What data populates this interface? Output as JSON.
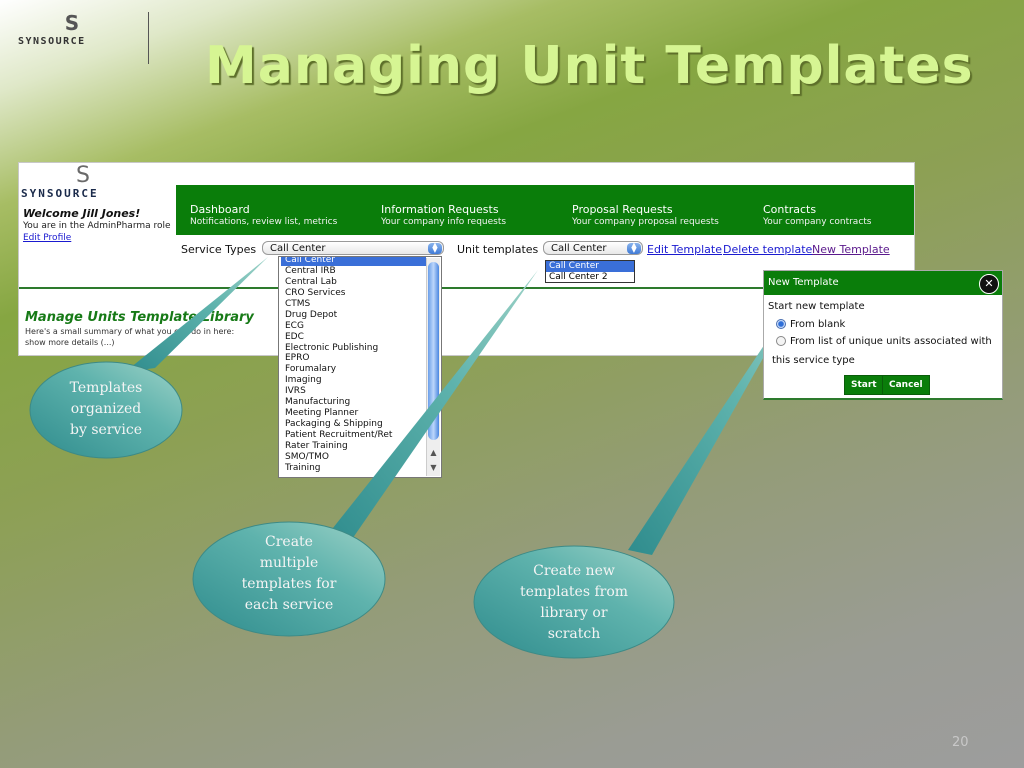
{
  "slide": {
    "title": "Managing Unit Templates",
    "logo_glyph": "S",
    "logo_wordmark": "SYNSOURCE",
    "page_number": "20"
  },
  "app": {
    "logo_glyph": "S",
    "logo_wordmark": "SYNSOURCE",
    "welcome": "Welcome Jill Jones!",
    "role_text": "You are in the AdminPharma role",
    "edit_profile": "Edit Profile",
    "nav": [
      {
        "label": "Dashboard",
        "sub": "Notifications, review list, metrics"
      },
      {
        "label": "Information Requests",
        "sub": "Your company info requests"
      },
      {
        "label": "Proposal Requests",
        "sub": "Your company proposal requests"
      },
      {
        "label": "Contracts",
        "sub": "Your company contracts"
      }
    ],
    "controls": {
      "service_types_label": "Service Types",
      "service_types_value": "Call Center",
      "unit_templates_label": "Unit templates",
      "unit_templates_value": "Call Center",
      "edit_template": "Edit Template",
      "delete_template": "Delete template",
      "new_template": "New Template"
    },
    "service_types_options": [
      "Call Center",
      "Central IRB",
      "Central Lab",
      "CRO Services",
      "CTMS",
      "Drug Depot",
      "ECG",
      "EDC",
      "Electronic Publishing",
      "EPRO",
      "Forumalary",
      "Imaging",
      "IVRS",
      "Manufacturing",
      "Meeting Planner",
      "Packaging & Shipping",
      "Patient Recruitment/Ret",
      "Rater Training",
      "SMO/TMO",
      "Training"
    ],
    "service_types_selected_index": 0,
    "unit_templates_options": [
      "Call Center",
      "Call Center 2"
    ],
    "unit_templates_selected_index": 0,
    "manage_title": "Manage Units Template Library",
    "manage_summary": "Here's a small summary of what you can do in here:",
    "manage_more": "show more details (...)"
  },
  "dialog": {
    "title": "New Template",
    "close_icon": "close-circle-icon",
    "prompt": "Start new template",
    "option_blank": "From blank",
    "option_list": "From list of unique units associated with",
    "option_list_cont": "this service type",
    "selected_option": "From blank",
    "start": "Start",
    "cancel": "Cancel"
  },
  "callouts": [
    {
      "lines": [
        "Templates",
        "organized",
        "by service"
      ]
    },
    {
      "lines": [
        "Create",
        "multiple",
        "templates for",
        "each service"
      ]
    },
    {
      "lines": [
        "Create new",
        "templates from",
        "library or",
        "scratch"
      ]
    }
  ],
  "colors": {
    "nav_green": "#0a7d0a",
    "title_text": "#d6f593",
    "callout_teal": "#4aa3a0",
    "selection_blue": "#3a6fd8"
  }
}
